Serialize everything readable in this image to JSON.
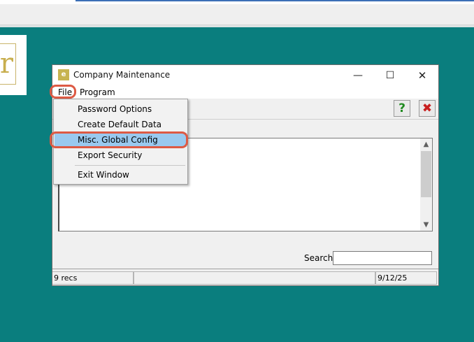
{
  "background": {
    "accent": "#0a7e7e",
    "logo_letter": "r"
  },
  "window": {
    "title": "Company Maintenance",
    "app_icon_text": "e",
    "controls": {
      "minimize": "—",
      "maximize": "☐",
      "close": "✕"
    },
    "menu": [
      "File",
      "Program"
    ],
    "toolbar": {
      "help_glyph": "?",
      "close_glyph": "✖"
    },
    "search": {
      "label": "Search:",
      "value": ""
    },
    "status": {
      "records": "9 recs",
      "middle": "",
      "date": "9/12/25"
    }
  },
  "file_menu": {
    "items": [
      {
        "label": "Password Options"
      },
      {
        "label": "Create Default Data"
      },
      {
        "label": "Misc. Global Config",
        "selected": true
      },
      {
        "label": "Export Security"
      },
      {
        "label": "Exit Window"
      }
    ]
  },
  "highlight_color": "#dd5a44"
}
